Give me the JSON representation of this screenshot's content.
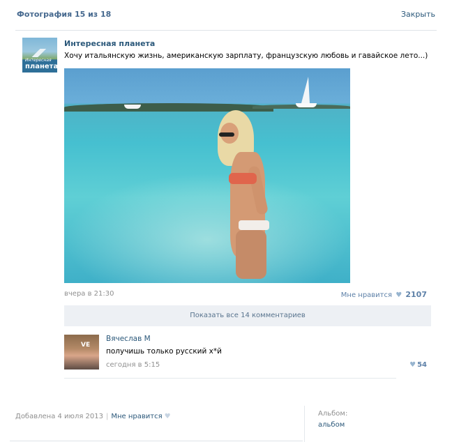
{
  "header": {
    "title": "Фотография 15 из 18",
    "close_label": "Закрыть"
  },
  "post": {
    "author": "Интересная планета",
    "avatar_caption_small": "Интересная",
    "avatar_caption_large": "планета",
    "text": "Хочу итальянскую жизнь, американскую зарплату, французскую любовь и гавайское лето...)",
    "date": "вчера в 21:30",
    "like_label": "Мне нравится",
    "like_count": "2107"
  },
  "comments": {
    "show_all_label": "Показать все 14 комментариев",
    "items": [
      {
        "author": "Вячеслав М",
        "avatar_caption": "VE",
        "text": "получишь только русский х*й",
        "date": "сегодня в 5:15",
        "likes": "54"
      }
    ]
  },
  "footer": {
    "added_label": "Добавлена 4 июля 2013",
    "separator": "|",
    "like_label": "Мне нравится",
    "album_label": "Альбом:",
    "album_link": "альбом"
  },
  "icons": {
    "heart": "heart-icon"
  },
  "colors": {
    "link": "#2b587a",
    "title": "#45688e",
    "muted": "#8f8f8f",
    "button_bg": "#edf0f4"
  }
}
